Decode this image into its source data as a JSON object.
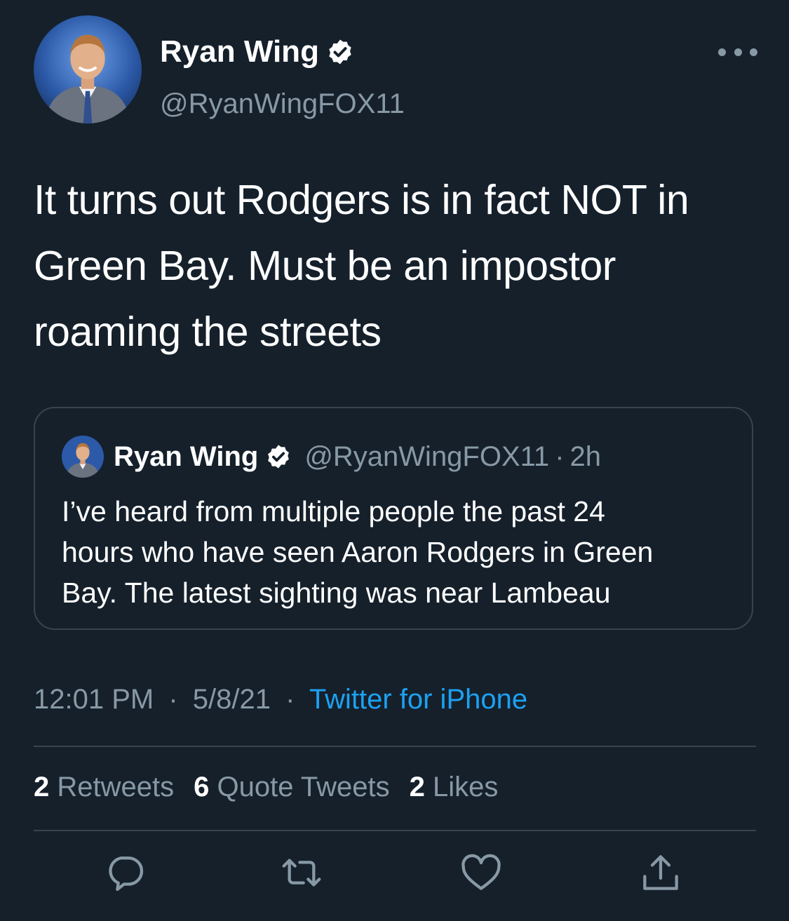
{
  "tweet": {
    "author": {
      "name": "Ryan Wing",
      "handle": "@RyanWingFOX11",
      "verified_icon": "verified-badge-icon"
    },
    "more_icon": "more-icon",
    "text_lines": [
      "It turns out Rodgers is in fact NOT in",
      "Green Bay. Must be an impostor",
      "roaming the streets"
    ],
    "quoted": {
      "name": "Ryan Wing",
      "handle": "@RyanWingFOX11",
      "separator": "·",
      "age": "2h",
      "text_lines": [
        "I’ve heard from multiple people the past 24",
        "hours who have seen Aaron Rodgers in Green",
        "Bay. The latest sighting was near Lambeau"
      ]
    },
    "time": "12:01 PM",
    "date": "5/8/21",
    "separator": "·",
    "source": "Twitter for iPhone",
    "stats": {
      "retweets_count": "2",
      "retweets_label": "Retweets",
      "quotes_count": "6",
      "quotes_label": "Quote Tweets",
      "likes_count": "2",
      "likes_label": "Likes"
    },
    "actions": [
      "reply-icon",
      "retweet-icon",
      "like-icon",
      "share-icon"
    ]
  },
  "colors": {
    "background": "#15202b",
    "text_primary": "#ffffff",
    "text_secondary": "#8899a6",
    "accent": "#1da1f2",
    "border": "#38444d"
  }
}
